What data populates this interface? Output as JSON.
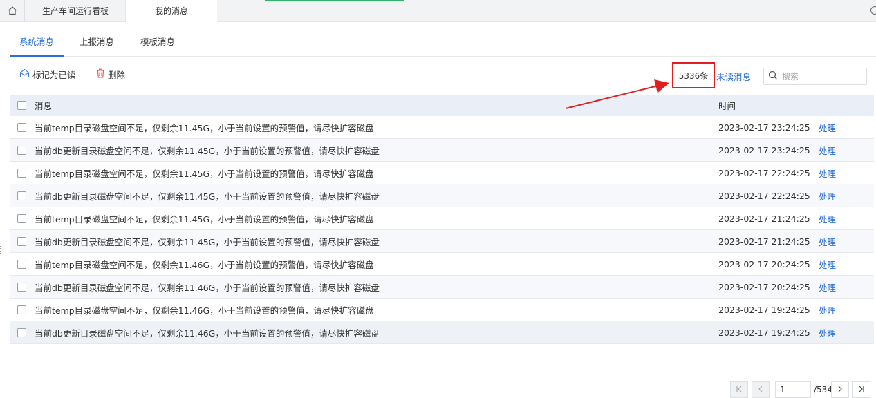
{
  "top_tabs": [
    {
      "label": "生产车间运行看板"
    },
    {
      "label": "我的消息"
    }
  ],
  "sub_tabs": [
    {
      "label": "系统消息",
      "active": true
    },
    {
      "label": "上报消息",
      "active": false
    },
    {
      "label": "模板消息",
      "active": false
    }
  ],
  "toolbar": {
    "mark_read_label": "标记为已读",
    "delete_label": "删除",
    "count": "5336条",
    "unread_label": "未读消息",
    "search_placeholder": "搜索"
  },
  "table": {
    "headers": {
      "message": "消息",
      "time": "时间"
    },
    "rows": [
      {
        "message": "当前temp目录磁盘空间不足，仅剩余11.45G，小于当前设置的预警值，请尽快扩容磁盘",
        "time": "2023-02-17 23:24:25",
        "action": "处理"
      },
      {
        "message": "当前db更新目录磁盘空间不足，仅剩余11.45G，小于当前设置的预警值，请尽快扩容磁盘",
        "time": "2023-02-17 23:24:25",
        "action": "处理"
      },
      {
        "message": "当前temp目录磁盘空间不足，仅剩余11.45G，小于当前设置的预警值，请尽快扩容磁盘",
        "time": "2023-02-17 22:24:25",
        "action": "处理"
      },
      {
        "message": "当前db更新目录磁盘空间不足，仅剩余11.45G，小于当前设置的预警值，请尽快扩容磁盘",
        "time": "2023-02-17 22:24:25",
        "action": "处理"
      },
      {
        "message": "当前temp目录磁盘空间不足，仅剩余11.45G，小于当前设置的预警值，请尽快扩容磁盘",
        "time": "2023-02-17 21:24:25",
        "action": "处理"
      },
      {
        "message": "当前db更新目录磁盘空间不足，仅剩余11.45G，小于当前设置的预警值，请尽快扩容磁盘",
        "time": "2023-02-17 21:24:25",
        "action": "处理"
      },
      {
        "message": "当前temp目录磁盘空间不足，仅剩余11.46G，小于当前设置的预警值，请尽快扩容磁盘",
        "time": "2023-02-17 20:24:25",
        "action": "处理"
      },
      {
        "message": "当前db更新目录磁盘空间不足，仅剩余11.46G，小于当前设置的预警值，请尽快扩容磁盘",
        "time": "2023-02-17 20:24:25",
        "action": "处理"
      },
      {
        "message": "当前temp目录磁盘空间不足，仅剩余11.46G，小于当前设置的预警值，请尽快扩容磁盘",
        "time": "2023-02-17 19:24:25",
        "action": "处理"
      },
      {
        "message": "当前db更新目录磁盘空间不足，仅剩余11.46G，小于当前设置的预警值，请尽快扩容磁盘",
        "time": "2023-02-17 19:24:25",
        "action": "处理"
      }
    ]
  },
  "pagination": {
    "current_page": "1",
    "total": "/534"
  },
  "colors": {
    "accent": "#2a6fd6",
    "highlight_box": "#e02020",
    "header_bg": "#e9eef7"
  }
}
